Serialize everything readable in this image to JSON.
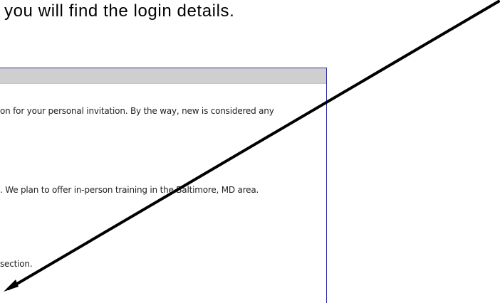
{
  "caption": "you will find the login details.",
  "panel": {
    "lines": [
      "on for your personal invitation. By the way, new is considered any",
      ". We plan to offer in-person training in the Baltimore, MD area.",
      "section."
    ]
  },
  "colors": {
    "panel_border": "#2e2ea8",
    "panel_header": "#cfcfcf",
    "arrow": "#000000"
  },
  "icons": {
    "annotation": "arrow-icon"
  }
}
